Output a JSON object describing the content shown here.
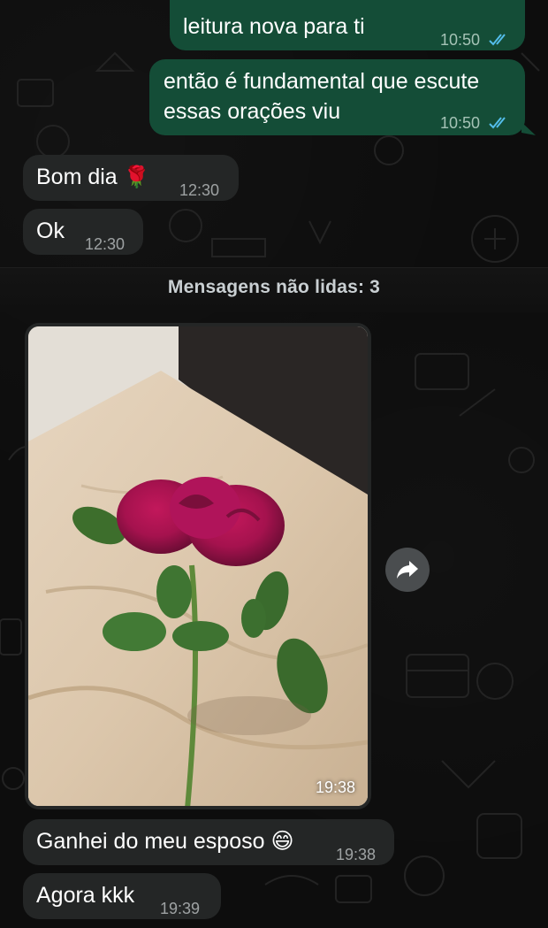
{
  "messages": {
    "out_1": {
      "text": "leitura nova para ti",
      "time": "10:50"
    },
    "out_2": {
      "line1": "então é fundamental que escute",
      "line2": "essas orações viu",
      "time": "10:50"
    },
    "in_1": {
      "text": "Bom dia",
      "emoji": "🌹",
      "time": "12:30"
    },
    "in_2": {
      "text": "Ok",
      "time": "12:30"
    },
    "photo": {
      "time": "19:38"
    },
    "in_3": {
      "text": "Ganhei do meu esposo",
      "emoji": "😄",
      "time": "19:38"
    },
    "in_4": {
      "text": "Agora kkk",
      "time": "19:39"
    }
  },
  "divider": {
    "label": "Mensagens não lidas: 3"
  },
  "icons": {
    "read_ticks": "double-check-icon",
    "forward": "forward-arrow-icon"
  },
  "colors": {
    "outgoing_bubble": "#144d37",
    "incoming_bubble": "#242626",
    "read_tick": "#53bdeb",
    "background": "#0b0b0b"
  }
}
